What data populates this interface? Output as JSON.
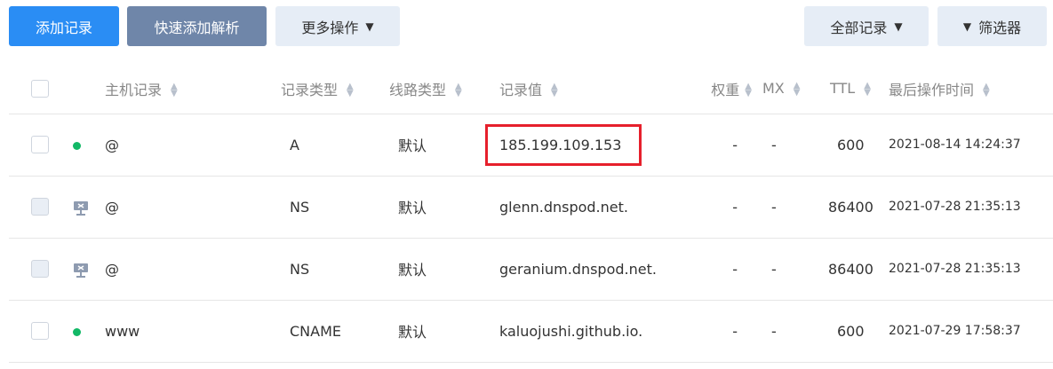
{
  "toolbar": {
    "add_record": "添加记录",
    "quick_add": "快速添加解析",
    "more_ops": "更多操作",
    "all_records": "全部记录",
    "filter": "筛选器"
  },
  "columns": {
    "host": "主机记录",
    "type": "记录类型",
    "line": "线路类型",
    "value": "记录值",
    "weight": "权重",
    "mx": "MX",
    "ttl": "TTL",
    "updated": "最后操作时间"
  },
  "rows": [
    {
      "status": "enabled",
      "host": "@",
      "type": "A",
      "line": "默认",
      "value": "185.199.109.153",
      "weight": "-",
      "mx": "-",
      "ttl": "600",
      "updated": "2021-08-14 14:24:37",
      "highlight": true
    },
    {
      "status": "system",
      "host": "@",
      "type": "NS",
      "line": "默认",
      "value": "glenn.dnspod.net.",
      "weight": "-",
      "mx": "-",
      "ttl": "86400",
      "updated": "2021-07-28 21:35:13"
    },
    {
      "status": "system",
      "host": "@",
      "type": "NS",
      "line": "默认",
      "value": "geranium.dnspod.net.",
      "weight": "-",
      "mx": "-",
      "ttl": "86400",
      "updated": "2021-07-28 21:35:13"
    },
    {
      "status": "enabled",
      "host": "www",
      "type": "CNAME",
      "line": "默认",
      "value": "kaluojushi.github.io.",
      "weight": "-",
      "mx": "-",
      "ttl": "600",
      "updated": "2021-07-29 17:58:37"
    }
  ],
  "colors": {
    "primary": "#2a8df4",
    "dark": "#6f86a9",
    "light": "#e6edf6",
    "status_green": "#12b866",
    "highlight_red": "#e6202c"
  }
}
